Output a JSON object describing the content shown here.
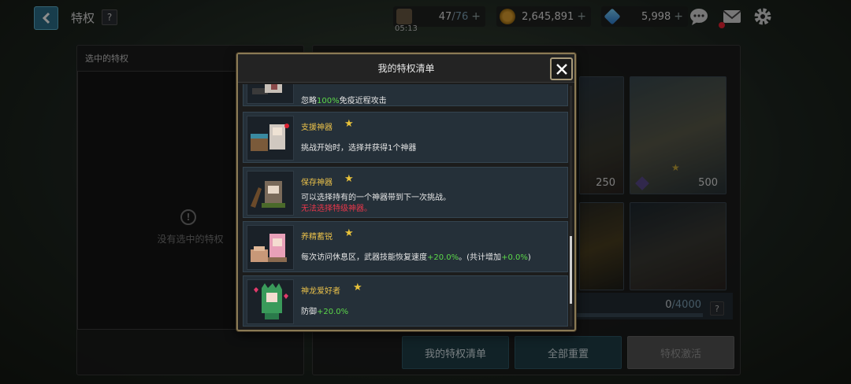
{
  "header": {
    "title": "特权",
    "help": "?",
    "stamina": {
      "value": "47",
      "max": "76",
      "timer": "05:13"
    },
    "gold": "2,645,891",
    "gems": "5,998",
    "plus": "+"
  },
  "left_panel": {
    "header": "选中的特权",
    "empty_text": "没有选中的特权"
  },
  "right_panel": {
    "cards": [
      {
        "cost": "250"
      },
      {
        "cost": "500"
      }
    ],
    "progress": {
      "current": "0",
      "max": "4000",
      "fraction": 0.0
    },
    "help": "?"
  },
  "buttons": {
    "my_list": "我的特权清单",
    "reset_all": "全部重置",
    "activate": "特权激活"
  },
  "modal": {
    "title": "我的特权清单",
    "scroll": {
      "position": 0.87,
      "visible_fraction": 0.28
    },
    "perks": [
      {
        "name": "",
        "desc_prefix": "忽略",
        "desc_highlight": "100%",
        "desc_suffix": "免疫近程攻击",
        "icon": "armored-hero-portrait"
      },
      {
        "name": "支援神器",
        "stars": "★",
        "desc": "挑战开始时，选择并获得1个神器",
        "icon": "artifact-chest-portrait"
      },
      {
        "name": "保存神器",
        "stars": "★",
        "desc": "可以选择持有的一个神器带到下一次挑战。",
        "warning": "无法选择特级神器。",
        "icon": "hooded-mage-portrait"
      },
      {
        "name": "养精蓄锐",
        "stars": "★",
        "desc_prefix": "每次访问休息区，武器技能恢复速度",
        "desc_highlight": "+20.0%",
        "desc_mid": "。(共计增加",
        "desc_highlight2": "+0.0%",
        "desc_suffix": ")",
        "icon": "resting-girl-portrait"
      },
      {
        "name": "神龙爱好者",
        "stars": "★",
        "desc_prefix": "防御",
        "desc_highlight": "+20.0%",
        "icon": "dragon-costume-portrait"
      }
    ]
  },
  "colors": {
    "accent_teal": "#2c6f8a",
    "perk_name_gold": "#e9c04a",
    "highlight_green": "#5cd84a",
    "warning_red": "#e8364a"
  }
}
